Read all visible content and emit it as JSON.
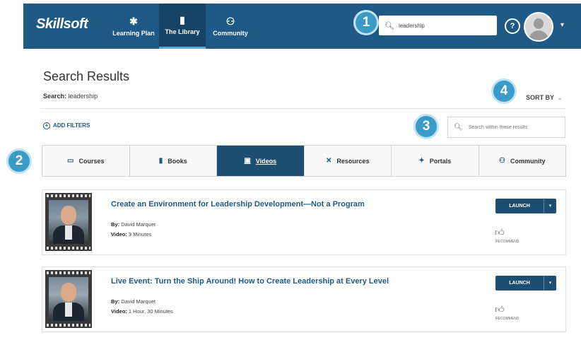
{
  "header": {
    "logo": "Skillsoft",
    "nav": [
      {
        "label": "Learning Plan",
        "icon": "puzzle-icon"
      },
      {
        "label": "The Library",
        "icon": "book-icon"
      },
      {
        "label": "Community",
        "icon": "people-icon"
      }
    ],
    "search_value": "leadership",
    "help": "?",
    "caret": "▾"
  },
  "callouts": [
    "1",
    "2",
    "3",
    "4"
  ],
  "page": {
    "title": "Search Results",
    "search_label": "Search:",
    "search_term": "leadership",
    "sort_by": "SORT BY",
    "add_filters": "ADD FILTERS",
    "within_placeholder": "Search within these results"
  },
  "tabs": [
    {
      "label": "Courses",
      "icon": "courses-icon"
    },
    {
      "label": "Books",
      "icon": "books-icon"
    },
    {
      "label": "Videos",
      "icon": "videos-icon",
      "active": true
    },
    {
      "label": "Resources",
      "icon": "resources-icon"
    },
    {
      "label": "Portals",
      "icon": "portals-icon"
    },
    {
      "label": "Community",
      "icon": "community-icon"
    }
  ],
  "results": [
    {
      "title": "Create an Environment for Leadership Development—Not a Program",
      "by_label": "By:",
      "author": "David Marquet",
      "type_label": "Video:",
      "duration": "3 Minutes",
      "launch": "LAUNCH",
      "recommend": "RECOMMEND"
    },
    {
      "title": "Live Event: Turn the Ship Around! How to Create Leadership at Every Level",
      "by_label": "By:",
      "author": "David Marquet",
      "type_label": "Video:",
      "duration": "1 Hour, 30 Minutes",
      "launch": "LAUNCH",
      "recommend": "RECOMMEND"
    }
  ],
  "colors": {
    "brand_blue": "#1e5a85",
    "active_tab": "#1e4f72",
    "callout": "#3a9bc6"
  }
}
